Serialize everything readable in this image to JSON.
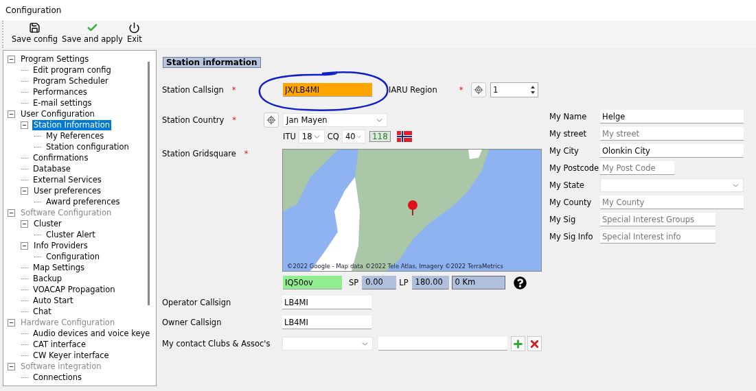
{
  "window": {
    "title": "Configuration"
  },
  "toolbar": [
    {
      "kind": "save",
      "label": "Save config"
    },
    {
      "kind": "apply",
      "label": "Save and apply"
    },
    {
      "kind": "exit",
      "label": "Exit"
    }
  ],
  "tree": [
    {
      "label": "Program Settings",
      "disabled": false,
      "selected": false,
      "children": [
        {
          "label": "Edit program config",
          "selected": false
        },
        {
          "label": "Program Scheduler",
          "selected": false
        },
        {
          "label": "Performances",
          "selected": false
        },
        {
          "label": "E-mail settings",
          "selected": false
        }
      ]
    },
    {
      "label": "User Configuration",
      "disabled": false,
      "selected": false,
      "children": [
        {
          "label": "Station Information",
          "selected": true,
          "children": [
            {
              "label": "My References",
              "selected": false
            },
            {
              "label": "Station configuration",
              "selected": false
            }
          ]
        },
        {
          "label": "Confirmations",
          "selected": false
        },
        {
          "label": "Database",
          "selected": false
        },
        {
          "label": "External Services",
          "selected": false
        },
        {
          "label": "User preferences",
          "selected": false,
          "children": [
            {
              "label": "Award preferences",
              "selected": false
            }
          ]
        }
      ]
    },
    {
      "label": "Software Configuration",
      "disabled": true,
      "selected": false,
      "children": [
        {
          "label": "Cluster",
          "selected": false,
          "children": [
            {
              "label": "Cluster Alert",
              "selected": false
            }
          ]
        },
        {
          "label": "Info Providers",
          "selected": false,
          "children": [
            {
              "label": "Configuration",
              "selected": false
            }
          ]
        },
        {
          "label": "Map Settings",
          "selected": false
        },
        {
          "label": "Backup",
          "selected": false
        },
        {
          "label": "VOACAP Propagation",
          "selected": false
        },
        {
          "label": "Auto Start",
          "selected": false
        },
        {
          "label": "Chat",
          "selected": false
        }
      ]
    },
    {
      "label": "Hardware Configuration",
      "disabled": true,
      "selected": false,
      "children": [
        {
          "label": "Audio devices and voice keye",
          "selected": false
        },
        {
          "label": "CAT interface",
          "selected": false
        },
        {
          "label": "CW Keyer interface",
          "selected": false
        }
      ]
    },
    {
      "label": "Software integration",
      "disabled": true,
      "selected": false,
      "children": [
        {
          "label": "Connections",
          "selected": false
        }
      ]
    }
  ],
  "section_title": "Station information",
  "callsign": {
    "label": "Station Callsign",
    "marker": "*",
    "value": "JX/LB4MI"
  },
  "iaru_region": {
    "label": "IARU Region",
    "marker": "*",
    "value": "1"
  },
  "country": {
    "label": "Station Country",
    "marker": "*",
    "value": "Jan Mayen"
  },
  "zones": {
    "itu_label": "ITU",
    "itu_value": "18",
    "cq_label": "CQ",
    "cq_value": "40",
    "dxcc": "118"
  },
  "gridsquare": {
    "label": "Station Gridsquare",
    "marker": "*",
    "attribution": "©2022 Google - Map data ©2022 Tele Atlas, Imagery ©2022 TerraMetrics",
    "locator": "IQ50ov",
    "sp_label": "SP",
    "sp_value": "0.00",
    "lp_label": "LP",
    "lp_value": "180.00",
    "distance": "0 Km"
  },
  "operator_callsign": {
    "label": "Operator Callsign",
    "value": "LB4MI"
  },
  "owner_callsign": {
    "label": "Owner Callsign",
    "value": "LB4MI"
  },
  "clubs": {
    "label": "My contact Clubs & Assoc's"
  },
  "personal": [
    {
      "label": "My Name",
      "kind": "text",
      "value": "Helge"
    },
    {
      "label": "My street",
      "kind": "text",
      "placeholder": "My street"
    },
    {
      "label": "My City",
      "kind": "text",
      "value": "Olonkin City"
    },
    {
      "label": "My Postcode",
      "kind": "short",
      "placeholder": "My Post Code"
    },
    {
      "label": "My State",
      "kind": "select"
    },
    {
      "label": "My County",
      "kind": "text",
      "placeholder": "My County"
    },
    {
      "label": "My Sig",
      "kind": "medium",
      "placeholder": "Special Interest Groups"
    },
    {
      "label": "My Sig Info",
      "kind": "medium",
      "placeholder": "Special Interest info"
    }
  ]
}
